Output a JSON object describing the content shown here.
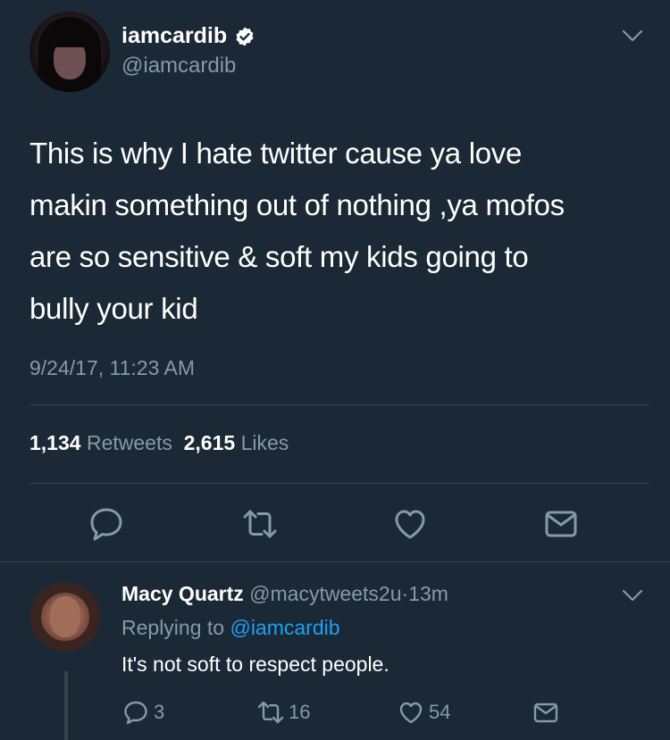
{
  "tweet": {
    "display_name": "iamcardib",
    "handle": "@iamcardib",
    "verified": true,
    "text_lines": [
      "This is why I hate twitter cause ya love",
      "makin something out of nothing ,ya mofos",
      "are so sensitive & soft my kids going to",
      "bully your kid"
    ],
    "timestamp": "9/24/17, 11:23 AM",
    "retweet_count": "1,134",
    "retweet_label": "Retweets",
    "like_count": "2,615",
    "like_label": "Likes",
    "actions": [
      "reply-icon",
      "retweet-icon",
      "like-icon",
      "message-icon"
    ]
  },
  "reply": {
    "display_name": "Macy Quartz",
    "handle": "@macytweets2u",
    "separator": "·",
    "time": "13m",
    "replying_prefix": "Replying to",
    "replying_to": "@iamcardib",
    "text": "It's not soft to respect people.",
    "reply_count": "3",
    "retweet_count": "16",
    "like_count": "54"
  },
  "colors": {
    "background": "#1b2836",
    "secondary_text": "#8899a6",
    "link": "#1da1f2",
    "divider": "#38444d",
    "verified": "#ffffff"
  }
}
